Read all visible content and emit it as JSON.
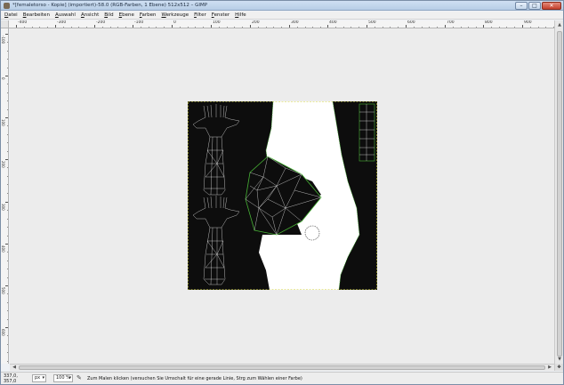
{
  "window": {
    "title": "*[femaletorso - Kopie] (importiert)-58.0 (RGB-Farben, 1 Ebene) 512x512 – GIMP"
  },
  "menu": [
    "Datei",
    "Bearbeiten",
    "Auswahl",
    "Ansicht",
    "Bild",
    "Ebene",
    "Farben",
    "Werkzeuge",
    "Filter",
    "Fenster",
    "Hilfe"
  ],
  "ruler": {
    "h_labels": [
      "-400",
      "-300",
      "-200",
      "-100",
      "0",
      "100",
      "200",
      "300",
      "400",
      "500",
      "600",
      "700",
      "800",
      "900"
    ],
    "v_labels": [
      "-100",
      "0",
      "100",
      "200",
      "300",
      "400",
      "500",
      "600"
    ]
  },
  "status": {
    "coords": "337,0, 357,0",
    "unit": "px",
    "zoom": "100 %",
    "message": "Zum Malen klicken (versuchen Sie Umschalt für eine gerade Linie, Strg zum Wählen einer Farbe)"
  },
  "colors": {
    "canvas_bg": "#ececec",
    "texture_dark": "#0d0d0d",
    "texture_light": "#ffffff",
    "wireframe": "#ffffff",
    "seam": "#46b034"
  },
  "icons": [
    "app-icon",
    "minimize-icon",
    "maximize-icon",
    "close-icon",
    "scroll-up-icon",
    "scroll-down-icon",
    "scroll-left-icon",
    "scroll-right-icon",
    "navigate-icon",
    "paintbrush-icon"
  ]
}
